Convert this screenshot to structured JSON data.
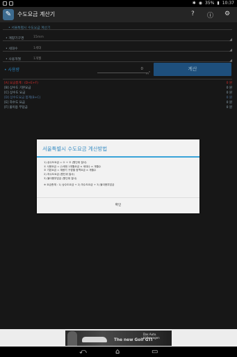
{
  "status": {
    "battery_percent": "35%",
    "time": "10:37"
  },
  "actionbar": {
    "title": "수도요금 계산기",
    "icon_glyph": "✎"
  },
  "form": {
    "section_title": "• 서울특별시 수도요금 계산기",
    "fields": [
      {
        "label": "• 계량기구경",
        "value": "15mm"
      },
      {
        "label": "• 세대수",
        "value": "1세대"
      },
      {
        "label": "• 사용개월",
        "value": "1개월"
      }
    ],
    "usage_label": "• 사용량",
    "usage_value": "0",
    "usage_unit": "m",
    "usage_unit_sup": "3",
    "calc_button": "계산"
  },
  "results": [
    {
      "label": "[A] 요금총계 : (D+E+F)",
      "value": "0 원",
      "color": "#d12b2b"
    },
    {
      "label": "[B] 상수도 기본요금",
      "value": "0 원",
      "color": "#8fa6b3"
    },
    {
      "label": "[C] 상수도 요금",
      "value": "0 원",
      "color": "#8fa6b3"
    },
    {
      "label": "[D] 상수도요금 합계(B+C)",
      "value": "0 원",
      "color": "#4f77a0"
    },
    {
      "label": "[E] 하수도 요금",
      "value": "0 원",
      "color": "#8fa6b3"
    },
    {
      "label": "[F] 물이용 부담금",
      "value": "0 원",
      "color": "#8fa6b3"
    }
  ],
  "dialog": {
    "title": "서울특별시 수도요금 계산방법",
    "body": [
      "1) 상수도요금 = ① + ② (원단위 절사)",
      "  ① 사용요금 = (1세대 1개월요금 × 세대수 × 개월수",
      "  ② 기본요금 = 계량기 구경별 정액요금 × 개월수",
      "2) 하수도요금 (원단위 절사)",
      "3) 물이용부담금 (원단위 절사)",
      "",
      "※ 요금총계 : 1) 상수도요금 + 2) 하수도요금 + 3) 물이용부담금"
    ],
    "ok": "확인"
  },
  "ad": {
    "brand": "Das Auto. Volkswagen",
    "headline": "The new Golf GTI"
  }
}
